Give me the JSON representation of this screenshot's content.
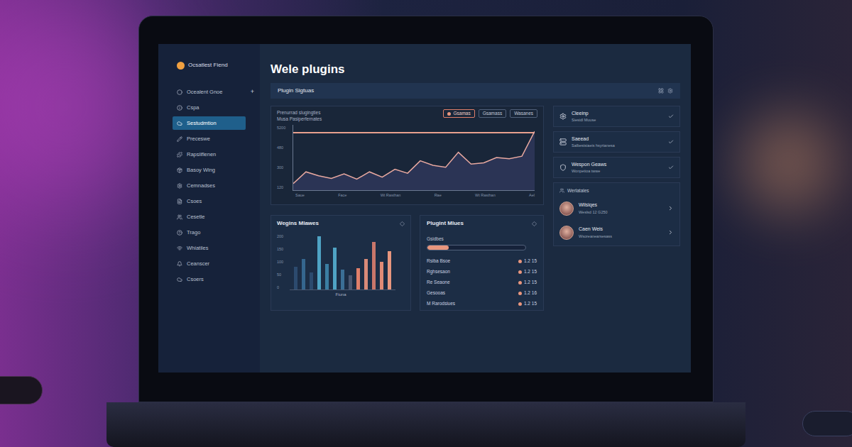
{
  "sidebar": {
    "logo": "Ocsatlest Fiend",
    "add_button": "+",
    "items": [
      {
        "label": "Ocealent Gnoe",
        "selected": false
      },
      {
        "label": "Cspa",
        "selected": false
      },
      {
        "label": "Sestudmtion",
        "selected": true
      },
      {
        "label": "Preceswe",
        "selected": false
      },
      {
        "label": "Rapsiiflenen",
        "selected": false
      },
      {
        "label": "Basoy Wing",
        "selected": false
      },
      {
        "label": "Cemnadses",
        "selected": false
      },
      {
        "label": "Csoes",
        "selected": false
      },
      {
        "label": "Cesetle",
        "selected": false
      },
      {
        "label": "Trago",
        "selected": false
      },
      {
        "label": "Whiatiles",
        "selected": false
      },
      {
        "label": "Ceanscer",
        "selected": false
      },
      {
        "label": "Csoers",
        "selected": false
      }
    ]
  },
  "page": {
    "title": "Wele plugins"
  },
  "chart": {
    "title": "Plugin Sigtuas",
    "subtitle": [
      "Prenurrad slugingties",
      "Musa Pasiperfernates"
    ],
    "filters": [
      {
        "label": "Gsamas",
        "selected": true
      },
      {
        "label": "Gsamass",
        "selected": false
      },
      {
        "label": "Wasanes",
        "selected": false
      }
    ],
    "y_ticks": [
      "5200",
      "480",
      "300",
      "120"
    ],
    "x_ticks": [
      "Saue",
      "Face",
      "Wt Rasthan",
      "Rae",
      "Wt Rasthan",
      "Ael"
    ],
    "series": [
      {
        "name": "usage",
        "values": [
          10,
          28,
          22,
          18,
          25,
          17,
          28,
          20,
          32,
          26,
          45,
          38,
          35,
          58,
          40,
          42,
          50,
          48,
          52,
          90
        ]
      },
      {
        "name": "target",
        "values": [
          88,
          88,
          88,
          88,
          88,
          88,
          88,
          88,
          88,
          88,
          88,
          88,
          88,
          88,
          88,
          88,
          88,
          88,
          88,
          88
        ]
      }
    ]
  },
  "bar_chart": {
    "title": "Wegins Mlawes",
    "y_ticks": [
      "200",
      "150",
      "100",
      "50",
      "0"
    ],
    "x_label": "Fiuna",
    "bars": [
      {
        "value": 40,
        "color": "#2c4a6e"
      },
      {
        "value": 55,
        "color": "#35668e"
      },
      {
        "value": 30,
        "color": "#2c4a6e"
      },
      {
        "value": 95,
        "color": "#4fa3c4"
      },
      {
        "value": 45,
        "color": "#3b7ea3"
      },
      {
        "value": 75,
        "color": "#4fa3c4"
      },
      {
        "value": 35,
        "color": "#3b6f96"
      },
      {
        "value": 25,
        "color": "#4a5670"
      },
      {
        "value": 38,
        "color": "#e07f6a"
      },
      {
        "value": 55,
        "color": "#d98a78"
      },
      {
        "value": 85,
        "color": "#c9766a"
      },
      {
        "value": 50,
        "color": "#e08a76"
      },
      {
        "value": 68,
        "color": "#e8967e"
      }
    ]
  },
  "plugin_list": {
    "title": "Plugint Mlues",
    "progress": {
      "label": "Gsidbes",
      "level": 0.22
    },
    "rows": [
      {
        "label": "Rsiba Bsoe",
        "value": "1.2 15"
      },
      {
        "label": "Rghsesaon",
        "value": "1.2 15"
      },
      {
        "label": "Re Seaone",
        "value": "1.2 15"
      },
      {
        "label": "Gesooas",
        "value": "1.2 16"
      },
      {
        "label": "M Rarodsiues",
        "value": "1.2 15"
      }
    ]
  },
  "status_cards": [
    {
      "title": "Cleeinp",
      "subtitle": "Siesidl Muuse",
      "checked": true
    },
    {
      "title": "Saeead",
      "subtitle": "Salbestsiaeis hsyrtanesa",
      "checked": true
    },
    {
      "title": "Wespon Geaws",
      "subtitle": "Wonpetioa twwe",
      "checked": true
    }
  ],
  "team": {
    "title": "Werlatales",
    "members": [
      {
        "name": "Wilsiqes",
        "detail": "Weslsd 12 G250"
      },
      {
        "name": "Caen Weis",
        "detail": "Wsoreanearsesass"
      }
    ]
  }
}
